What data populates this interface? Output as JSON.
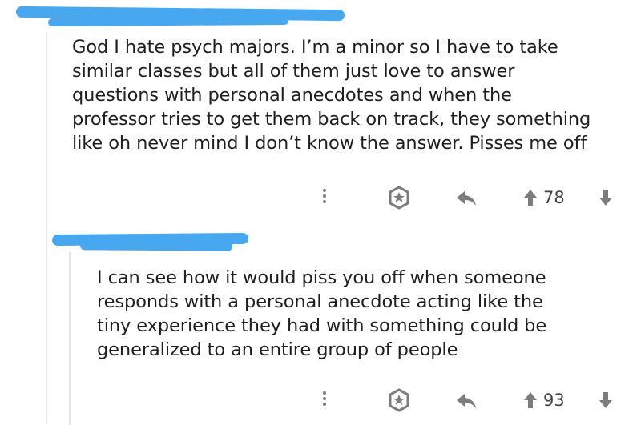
{
  "colors": {
    "redaction": "#47a8f0",
    "icon": "#7c7c7c",
    "thread_line": "#e6e6e6"
  },
  "comments": [
    {
      "lines": [
        "God I hate psych majors. I’m a minor so I have to take",
        "similar classes but all of them just love to answer",
        "questions with personal anecdotes and when the",
        "professor tries to get them back on track, they something",
        "like oh never mind I don’t know the answer. Pisses me off"
      ],
      "votes": "78",
      "icons": [
        "more-icon",
        "award-icon",
        "reply-icon",
        "upvote-icon",
        "downvote-icon"
      ]
    },
    {
      "lines": [
        "I can see how it would piss you off when someone",
        "responds with a personal anecdote acting like the",
        "tiny experience they had with something could be",
        "generalized to an entire group of people"
      ],
      "votes": "93",
      "icons": [
        "more-icon",
        "award-icon",
        "reply-icon",
        "upvote-icon",
        "downvote-icon"
      ]
    }
  ]
}
